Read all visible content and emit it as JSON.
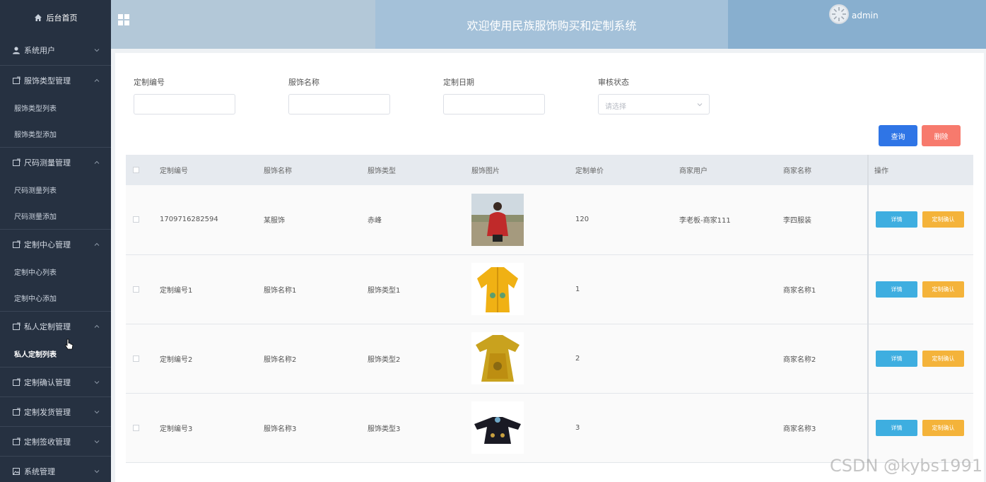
{
  "sidebar": {
    "home": "后台首页",
    "groups": [
      {
        "label": "系统用户"
      },
      {
        "label": "服饰类型管理",
        "subs": [
          "服饰类型列表",
          "服饰类型添加"
        ]
      },
      {
        "label": "尺码测量管理",
        "subs": [
          "尺码测量列表",
          "尺码测量添加"
        ]
      },
      {
        "label": "定制中心管理",
        "subs": [
          "定制中心列表",
          "定制中心添加"
        ]
      },
      {
        "label": "私人定制管理",
        "subs": [
          "私人定制列表"
        ]
      },
      {
        "label": "定制确认管理"
      },
      {
        "label": "定制发货管理"
      },
      {
        "label": "定制签收管理"
      },
      {
        "label": "系统管理"
      }
    ]
  },
  "header": {
    "title": "欢迎使用民族服饰购买和定制系统",
    "user": "admin"
  },
  "filters": {
    "f1_label": "定制编号",
    "f2_label": "服饰名称",
    "f3_label": "定制日期",
    "f4_label": "审核状态",
    "f4_placeholder": "请选择"
  },
  "actions": {
    "query": "查询",
    "delete": "删除"
  },
  "table": {
    "headers": [
      "定制编号",
      "服饰名称",
      "服饰类型",
      "服饰图片",
      "定制单价",
      "商家用户",
      "商家名称",
      "操作"
    ],
    "rows": [
      {
        "id": "1709716282594",
        "name": "某服饰",
        "type": "赤峰",
        "price": "120",
        "merchant_user": "李老板-商家111",
        "merchant_name": "李四服装"
      },
      {
        "id": "定制编号1",
        "name": "服饰名称1",
        "type": "服饰类型1",
        "price": "1",
        "merchant_user": "",
        "merchant_name": "商家名称1"
      },
      {
        "id": "定制编号2",
        "name": "服饰名称2",
        "type": "服饰类型2",
        "price": "2",
        "merchant_user": "",
        "merchant_name": "商家名称2"
      },
      {
        "id": "定制编号3",
        "name": "服饰名称3",
        "type": "服饰类型3",
        "price": "3",
        "merchant_user": "",
        "merchant_name": "商家名称3"
      }
    ],
    "detail_label": "详情",
    "confirm_label": "定制确认"
  },
  "watermark": "CSDN @kybs1991"
}
